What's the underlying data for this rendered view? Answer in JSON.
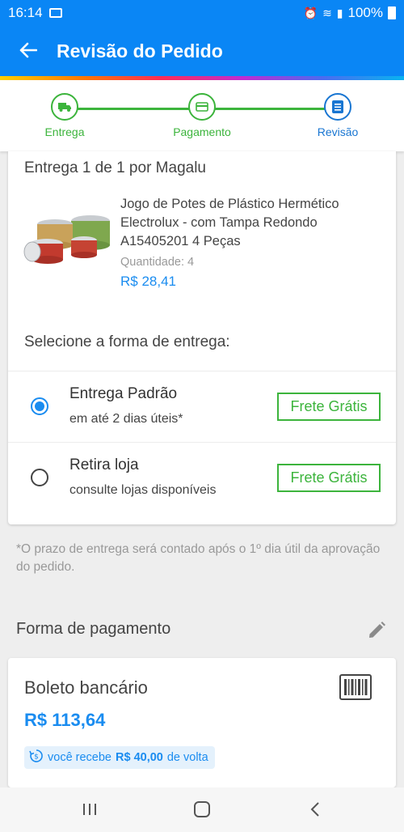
{
  "status_bar": {
    "time": "16:14",
    "battery": "100%"
  },
  "header": {
    "title": "Revisão do Pedido"
  },
  "steps": [
    {
      "label": "Entrega",
      "state": "done"
    },
    {
      "label": "Pagamento",
      "state": "done"
    },
    {
      "label": "Revisão",
      "state": "current"
    }
  ],
  "delivery": {
    "header": "Entrega 1 de 1 por Magalu",
    "product": {
      "name": "Jogo de Potes de Plástico Hermético Electrolux - com Tampa Redondo A15405201 4 Peças",
      "quantity_label": "Quantidade:",
      "quantity": "4",
      "price": "R$ 28,41"
    },
    "select_title": "Selecione a forma de entrega:",
    "options": [
      {
        "title": "Entrega Padrão",
        "subtitle": "em até 2 dias úteis*",
        "badge": "Frete Grátis",
        "selected": true
      },
      {
        "title": "Retira loja",
        "subtitle": "consulte lojas disponíveis",
        "badge": "Frete Grátis",
        "selected": false
      }
    ]
  },
  "note": "*O prazo de entrega será contado após o 1º dia útil da aprovação do pedido.",
  "payment": {
    "title": "Forma de pagamento",
    "method": "Boleto bancário",
    "amount": "R$ 113,64",
    "cashback_prefix": "você recebe",
    "cashback_value": "R$ 40,00",
    "cashback_suffix": "de volta"
  },
  "colors": {
    "primary": "#0a86f5",
    "success": "#3cb43c",
    "link": "#1a8cf0"
  },
  "icons": [
    "back-arrow-icon",
    "truck-icon",
    "card-icon",
    "document-icon",
    "edit-pencil-icon",
    "barcode-icon",
    "cashback-icon",
    "recent-apps-icon",
    "home-icon",
    "back-nav-icon"
  ]
}
